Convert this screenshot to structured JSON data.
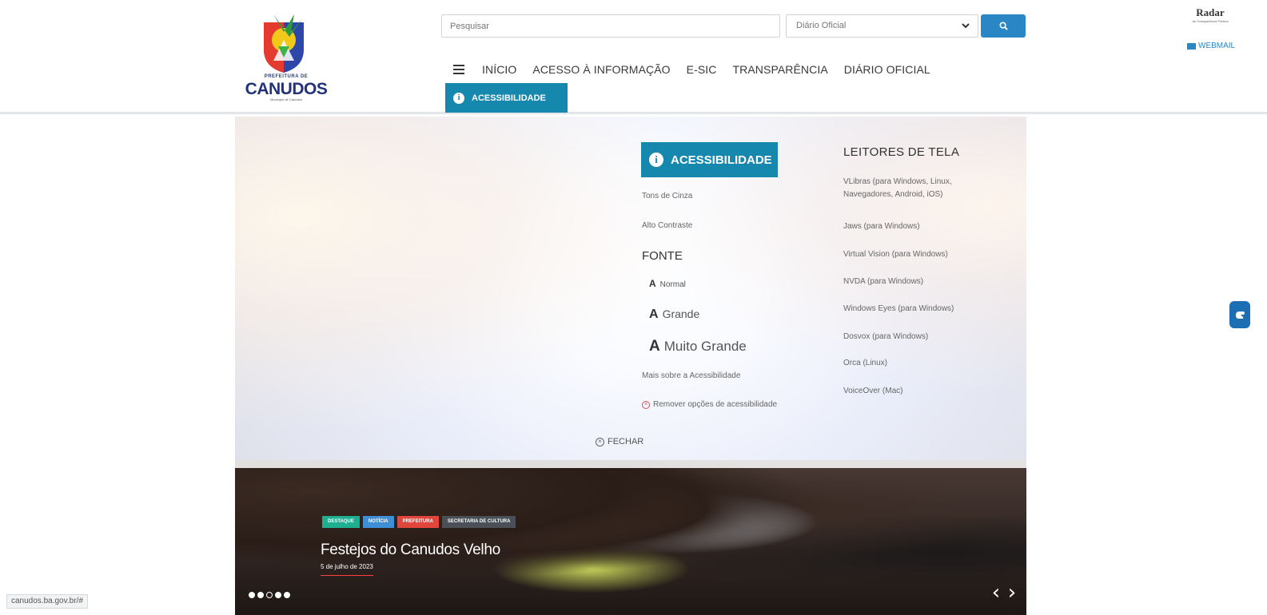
{
  "header": {
    "logo": {
      "prefix": "PREFEITURA DE",
      "name": "CANUDOS",
      "tagline": "Município de Canudos"
    },
    "search": {
      "placeholder": "Pesquisar",
      "scope_selected": "Diário Oficial",
      "button_icon": "search-icon"
    },
    "nav": {
      "menu_icon": "hamburger-icon",
      "items": [
        "INÍCIO",
        "ACESSO À INFORMAÇÃO",
        "E-SIC",
        "TRANSPARÊNCIA",
        "DIÁRIO OFICIAL"
      ]
    },
    "accessibility_tab": "ACESSIBILIDADE",
    "radar": {
      "title": "Radar",
      "subtitle": "da Transparência Pública"
    },
    "webmail": "WEBMAIL"
  },
  "accessibility_panel": {
    "title": "ACESSIBILIDADE",
    "contrast": [
      "Tons de Cinza",
      "Alto Contraste"
    ],
    "font_title": "FONTE",
    "font_options": [
      "Normal",
      "Grande",
      "Muito Grande"
    ],
    "font_glyph": "A",
    "more_link": "Mais sobre a Acessibilidade",
    "remove_link": "Remover opções de acessibilidade",
    "close_label": "FECHAR",
    "readers_title": "LEITORES DE TELA",
    "readers": [
      "VLibras (para Windows, Linux, Navegadores, Android, iOS)",
      "Jaws (para Windows)",
      "Virtual Vision (para Windows)",
      "NVDA (para Windows)",
      "Windows Eyes (para Windows)",
      "Dosvox (para Windows)",
      "Orca (Linux)",
      "VoiceOver (Mac)"
    ]
  },
  "slide": {
    "tags": [
      {
        "label": "DESTAQUE",
        "color": "#1fae8f"
      },
      {
        "label": "NOTÍCIA",
        "color": "#3f8fd6"
      },
      {
        "label": "PREFEITURA",
        "color": "#e2453c"
      },
      {
        "label": "SECRETARIA DE CULTURA",
        "color": "#4a4f58"
      }
    ],
    "title": "Festejos do Canudos Velho",
    "date": "5 de julho de 2023",
    "dots_active": [
      true,
      true,
      false,
      true,
      true
    ],
    "prev_icon": "chevron-left-icon",
    "next_icon": "chevron-right-icon"
  },
  "status_bar_url": "canudos.ba.gov.br/#",
  "colors": {
    "accent": "#1687ad",
    "search_button": "#2a86c4",
    "remove_red": "#d9534f"
  }
}
